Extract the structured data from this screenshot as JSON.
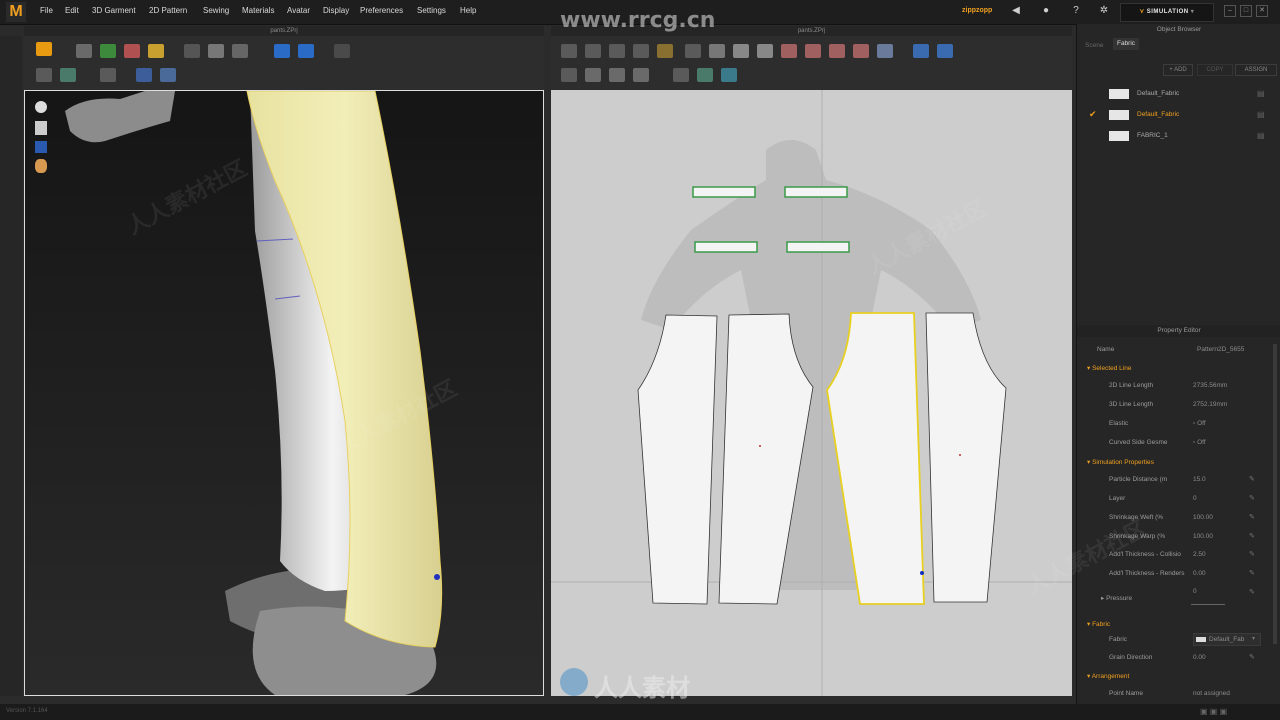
{
  "app": {
    "logo": "M",
    "user": "zippzopp",
    "simulation_label": "SIMULATION"
  },
  "menu": [
    "File",
    "Edit",
    "3D Garment",
    "2D Pattern",
    "Sewing",
    "Materials",
    "Avatar",
    "Display",
    "Preferences",
    "Settings",
    "Help"
  ],
  "panels": {
    "left_title": "pants.ZPrj",
    "right_title": "pants.ZPrj"
  },
  "object_browser": {
    "title": "Object Browser",
    "tabs": [
      "Scene",
      "Fabric"
    ],
    "buttons": {
      "add": "+ ADD",
      "copy": "COPY",
      "assign": "ASSIGN"
    },
    "fabrics": [
      {
        "name": "Default_Fabric",
        "selected": false
      },
      {
        "name": "Default_Fabric",
        "selected": true
      },
      {
        "name": "FABRIC_1",
        "selected": false
      }
    ]
  },
  "property_editor": {
    "title": "Property Editor",
    "name_label": "Name",
    "name_value": "Pattern2D_5655",
    "selected_line": {
      "header": "Selected Line",
      "rows": [
        {
          "label": "2D Line Length",
          "value": "2735.56mm"
        },
        {
          "label": "3D Line Length",
          "value": "2752.19mm"
        },
        {
          "label": "Elastic",
          "value": "Off"
        },
        {
          "label": "Curved Side Gesme",
          "value": "Off"
        }
      ]
    },
    "simulation": {
      "header": "Simulation Properties",
      "rows": [
        {
          "label": "Particle Distance (m",
          "value": "15.0"
        },
        {
          "label": "Layer",
          "value": "0"
        },
        {
          "label": "Shrinkage Weft (%",
          "value": "100.00"
        },
        {
          "label": "Shrinkage Warp (%",
          "value": "100.00"
        },
        {
          "label": "Add'l Thickness - Collisio",
          "value": "2.50"
        },
        {
          "label": "Add'l Thickness - Renders",
          "value": "0.00"
        }
      ],
      "pressure_label": "Pressure",
      "pressure_value": "0"
    },
    "fabric": {
      "header": "Fabric",
      "fabric_label": "Fabric",
      "fabric_value": "Default_Fab",
      "grain_label": "Grain Direction",
      "grain_value": "0.00"
    },
    "arrangement": {
      "header": "Arrangement",
      "point_label": "Point Name",
      "point_value": "not assigned"
    }
  },
  "watermark": {
    "site": "www.rrcg.cn",
    "brand": "人人素材",
    "tile": "人人素材社区"
  },
  "status": {
    "version": "Version 7.1.164"
  }
}
